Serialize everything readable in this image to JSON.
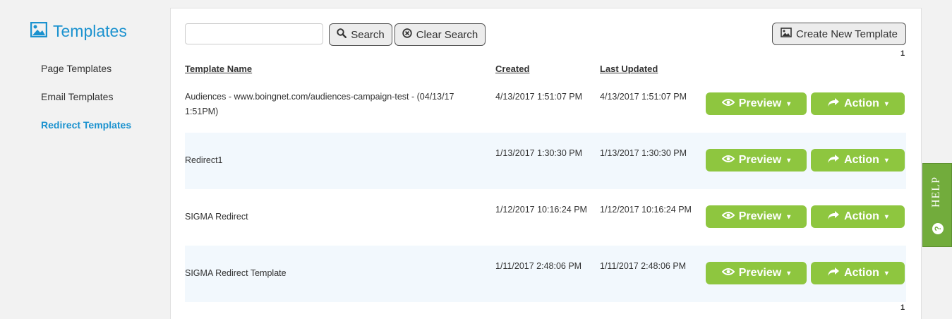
{
  "sidebar": {
    "title": "Templates",
    "items": [
      {
        "label": "Page Templates"
      },
      {
        "label": "Email Templates"
      },
      {
        "label": "Redirect Templates"
      }
    ]
  },
  "toolbar": {
    "search_value": "",
    "search_label": "Search",
    "clear_label": "Clear Search",
    "create_label": "Create New Template",
    "page_top": "1",
    "page_bottom": "1"
  },
  "table": {
    "headers": {
      "name": "Template Name",
      "created": "Created",
      "updated": "Last Updated"
    },
    "preview_label": "Preview",
    "action_label": "Action",
    "rows": [
      {
        "name": "Audiences - www.boingnet.com/audiences-campaign-test - (04/13/17 1:51PM)",
        "created": "4/13/2017 1:51:07 PM",
        "updated": "4/13/2017 1:51:07 PM"
      },
      {
        "name": "Redirect1",
        "created": "1/13/2017 1:30:30 PM",
        "updated": "1/13/2017 1:30:30 PM"
      },
      {
        "name": "SIGMA Redirect",
        "created": "1/12/2017 10:16:24 PM",
        "updated": "1/12/2017 10:16:24 PM"
      },
      {
        "name": "SIGMA Redirect Template",
        "created": "1/11/2017 2:48:06 PM",
        "updated": "1/11/2017 2:48:06 PM"
      }
    ]
  },
  "help": {
    "label": "HELP",
    "icon": "?"
  },
  "colors": {
    "accent": "#1b92cf",
    "button_green": "#8ec63f",
    "help_green": "#72ac3c",
    "row_alt": "#f2f8fd"
  }
}
